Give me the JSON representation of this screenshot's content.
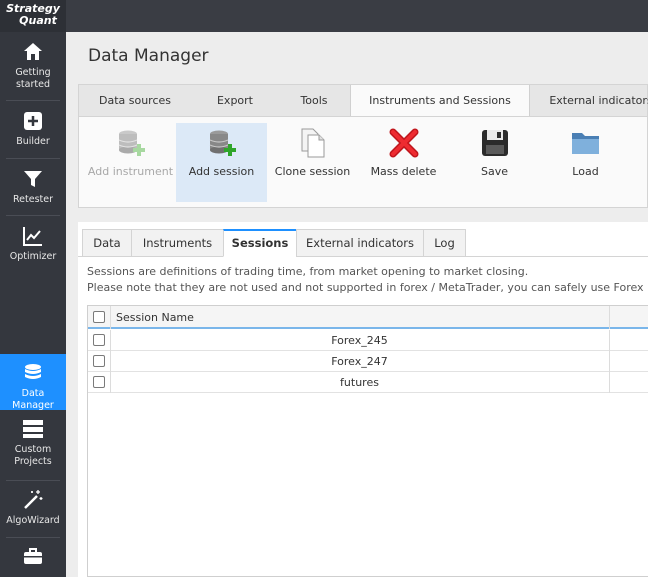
{
  "sidebar": {
    "logo_line1": "Strategy",
    "logo_line2": "Quant",
    "items": [
      {
        "line1": "Getting",
        "line2": "started"
      },
      {
        "line1": "Builder",
        "line2": ""
      },
      {
        "line1": "Retester",
        "line2": ""
      },
      {
        "line1": "Optimizer",
        "line2": ""
      },
      {
        "line1": "Data Manager",
        "line2": ""
      },
      {
        "line1": "Custom",
        "line2": "Projects"
      },
      {
        "line1": "AlgoWizard",
        "line2": ""
      }
    ]
  },
  "page": {
    "title": "Data Manager"
  },
  "outer_tabs": [
    "Data sources",
    "Export",
    "Tools",
    "Instruments and Sessions",
    "External indicators"
  ],
  "toolbar": {
    "add_instrument": "Add instrument",
    "add_session": "Add session",
    "clone_session": "Clone session",
    "mass_delete": "Mass delete",
    "save": "Save",
    "load": "Load"
  },
  "inner_tabs": [
    "Data",
    "Instruments",
    "Sessions",
    "External indicators",
    "Log"
  ],
  "description": {
    "line1": "Sessions are definitions of trading time, from market opening to market closing.",
    "line2": "Please note that they are not used and not supported in forex / MetaTrader, you can safely use Forex"
  },
  "grid": {
    "header": "Session Name",
    "rows": [
      "Forex_245",
      "Forex_247",
      "futures"
    ]
  },
  "colors": {
    "accent": "#1e90ff",
    "sidebar": "#34373e"
  }
}
